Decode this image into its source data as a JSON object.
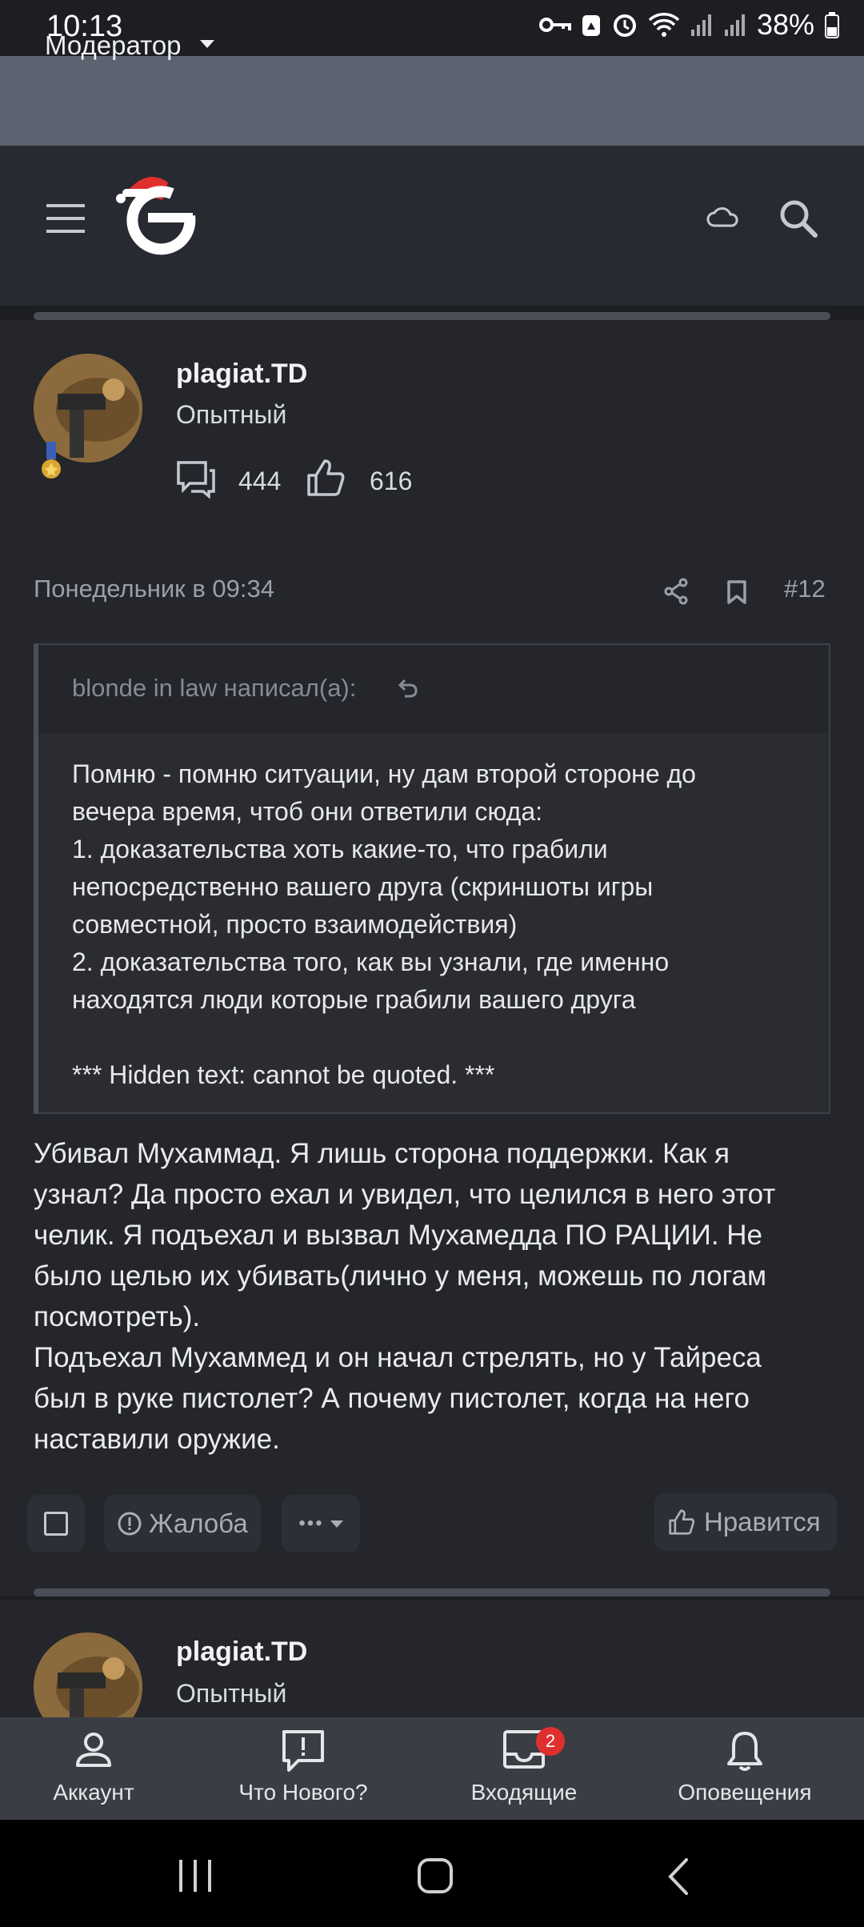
{
  "status_bar": {
    "time": "10:13",
    "battery": "38%"
  },
  "mod_bar": {
    "label": "Модератор"
  },
  "post": {
    "username": "plagiat.TD",
    "user_title": "Опытный",
    "messages_count": "444",
    "reactions_count": "616",
    "date": "Понедельник в 09:34",
    "number": "#12",
    "quote": {
      "author": "blonde in law написал(а):",
      "text": "Помню - помню ситуации, ну дам второй стороне до\nвечера время, чтоб они ответили сюда:\n1. доказательства хоть какие-то, что грабили\nнепосредственно вашего друга (скриншоты игры\nсовместной, просто взаимодействия)\n2. доказательства того, как вы узнали, где именно\nнаходятся люди которые грабили вашего друга\n\n*** Hidden text: cannot be quoted. ***"
    },
    "body": "Убивал Мухаммад. Я лишь сторона поддержки. Как я\nузнал? Да просто ехал и увидел, что целился в него этот\nчелик. Я подъехал и вызвал Мухамедда ПО РАЦИИ. Не\nбыло целью их убивать(лично у меня, можешь по логам\nпосмотреть).\nПодъехал Мухаммед и он начал стрелять, но у Тайреса\nбыл в руке пистолет? А почему пистолет, когда на него\nнаставили оружие.",
    "actions": {
      "report": "Жалоба",
      "more": "•••",
      "like": "Нравится"
    }
  },
  "next_post": {
    "username": "plagiat.TD",
    "user_title": "Опытный"
  },
  "bottom_nav": {
    "account": "Аккаунт",
    "whats_new": "Что Нового?",
    "inbox": "Входящие",
    "inbox_badge": "2",
    "alerts": "Оповещения"
  },
  "colors": {
    "accent_badge": "#e0302e",
    "mod_bar": "#5b6270",
    "header": "#272a30"
  }
}
